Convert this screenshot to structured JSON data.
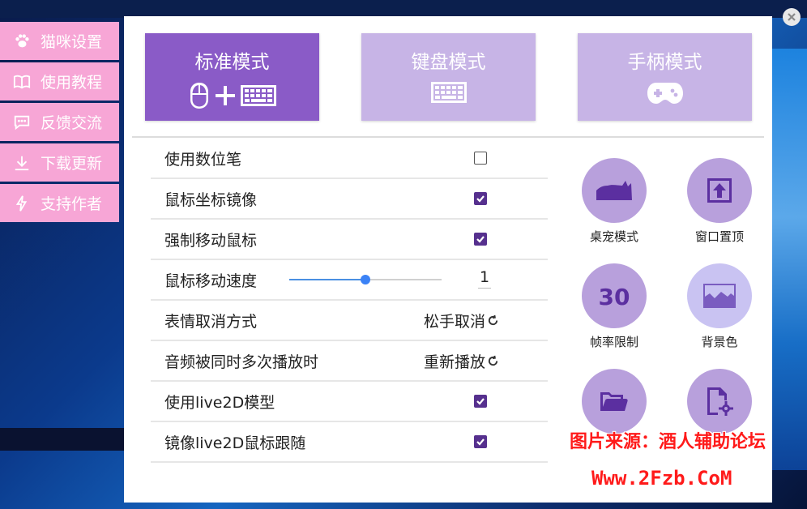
{
  "side_menu": [
    {
      "label": "猫咪设置",
      "icon": "paw-icon"
    },
    {
      "label": "使用教程",
      "icon": "book-icon"
    },
    {
      "label": "反馈交流",
      "icon": "chat-icon"
    },
    {
      "label": "下载更新",
      "icon": "download-icon"
    },
    {
      "label": "支持作者",
      "icon": "lightning-icon"
    }
  ],
  "modes": [
    {
      "label": "标准模式",
      "active": true,
      "icons": [
        "mouse-icon",
        "plus-icon",
        "keyboard-icon"
      ]
    },
    {
      "label": "键盘模式",
      "active": false,
      "icons": [
        "keyboard-icon"
      ]
    },
    {
      "label": "手柄模式",
      "active": false,
      "icons": [
        "gamepad-icon"
      ]
    }
  ],
  "settings": {
    "use_pen": {
      "label": "使用数位笔",
      "checked": false
    },
    "mouse_mirror": {
      "label": "鼠标坐标镜像",
      "checked": true
    },
    "force_move": {
      "label": "强制移动鼠标",
      "checked": true
    },
    "mouse_speed": {
      "label": "鼠标移动速度",
      "value": "1",
      "slider_fraction": 0.5
    },
    "emote_cancel": {
      "label": "表情取消方式",
      "value": "松手取消"
    },
    "audio_repeat": {
      "label": "音频被同时多次播放时",
      "value": "重新播放"
    },
    "use_live2d": {
      "label": "使用live2D模型",
      "checked": true
    },
    "mirror_live2d": {
      "label": "镜像live2D鼠标跟随",
      "checked": true
    }
  },
  "tools": [
    {
      "label": "桌宠模式",
      "icon": "cat-silhouette-icon"
    },
    {
      "label": "窗口置顶",
      "icon": "pin-top-icon"
    },
    {
      "label": "帧率限制",
      "icon": "fps-30-icon",
      "text": "30"
    },
    {
      "label": "背景色",
      "icon": "image-icon"
    },
    {
      "label": "",
      "icon": "folder-open-icon"
    },
    {
      "label": "",
      "icon": "file-settings-icon"
    }
  ],
  "watermark": {
    "line1": "图片来源：酒人辅助论坛",
    "line2": "Www.2Fzb.CoM"
  },
  "colors": {
    "menu_pink": "#f7a6d6",
    "mode_active": "#8a5bc7",
    "mode_inactive": "#c7b4e6",
    "checkbox": "#56308e",
    "tool_circle": "#b8a0dc",
    "slider": "#3b82f6"
  }
}
